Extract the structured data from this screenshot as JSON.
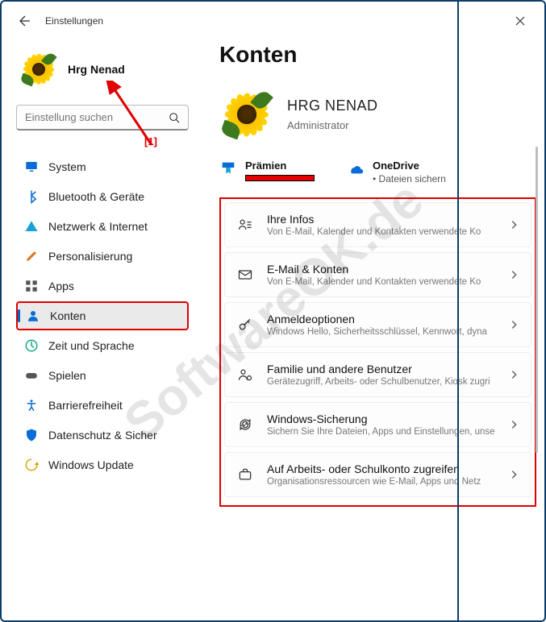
{
  "window": {
    "title": "Einstellungen"
  },
  "user": {
    "name": "Hrg Nenad"
  },
  "search": {
    "placeholder": "Einstellung suchen"
  },
  "annotations": {
    "marker1": "[1]",
    "watermark": "SoftwareOK.de"
  },
  "sidebar": {
    "items": [
      {
        "icon": "display-icon",
        "label": "System"
      },
      {
        "icon": "bluetooth-icon",
        "label": "Bluetooth & Geräte"
      },
      {
        "icon": "wifi-icon",
        "label": "Netzwerk & Internet"
      },
      {
        "icon": "brush-icon",
        "label": "Personalisierung"
      },
      {
        "icon": "apps-icon",
        "label": "Apps"
      },
      {
        "icon": "person-icon",
        "label": "Konten"
      },
      {
        "icon": "clock-globe-icon",
        "label": "Zeit und Sprache"
      },
      {
        "icon": "gamepad-icon",
        "label": "Spielen"
      },
      {
        "icon": "accessibility-icon",
        "label": "Barrierefreiheit"
      },
      {
        "icon": "shield-icon",
        "label": "Datenschutz & Sicher"
      },
      {
        "icon": "update-icon",
        "label": "Windows Update"
      }
    ],
    "selected_index": 5
  },
  "page": {
    "title": "Konten",
    "account": {
      "name": "HRG NENAD",
      "role": "Administrator"
    },
    "tiles": {
      "rewards": {
        "title": "Prämien"
      },
      "onedrive": {
        "title": "OneDrive",
        "sub": "• Dateien sichern"
      }
    },
    "rows": [
      {
        "icon": "your-info-icon",
        "title": "Ihre Infos",
        "sub": "Von E-Mail, Kalender und Kontakten verwendete Ko"
      },
      {
        "icon": "mail-icon",
        "title": "E-Mail & Konten",
        "sub": "Von E-Mail, Kalender und Kontakten verwendete Ko"
      },
      {
        "icon": "key-icon",
        "title": "Anmeldeoptionen",
        "sub": "Windows Hello, Sicherheitsschlüssel, Kennwort, dyna"
      },
      {
        "icon": "family-icon",
        "title": "Familie und andere Benutzer",
        "sub": "Gerätezugriff, Arbeits- oder Schulbenutzer, Kiosk zugri"
      },
      {
        "icon": "backup-icon",
        "title": "Windows-Sicherung",
        "sub": "Sichern Sie Ihre Dateien, Apps und Einstellungen, unse wiederherzustellen."
      },
      {
        "icon": "briefcase-icon",
        "title": "Auf Arbeits- oder Schulkonto zugreifen",
        "sub": "Organisationsressourcen wie E-Mail, Apps und Netz"
      }
    ]
  }
}
